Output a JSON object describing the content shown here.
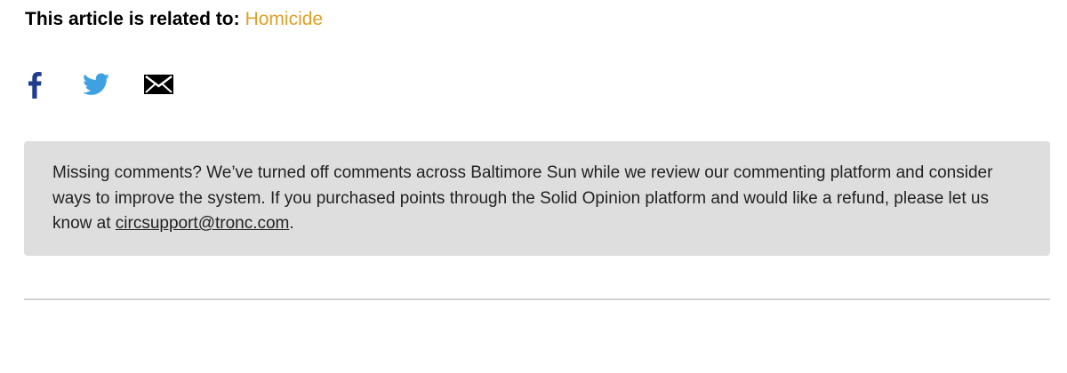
{
  "related": {
    "label": "This article is related to:",
    "topic": "Homicide"
  },
  "share": {
    "facebook_icon": "facebook-icon",
    "twitter_icon": "twitter-icon",
    "email_icon": "email-icon"
  },
  "notice": {
    "text": "Missing comments? We’ve turned off comments across Baltimore Sun while we review our commenting platform and consider ways to improve the system. If you purchased points through the Solid Opinion platform and would like a refund, please let us know at ",
    "email": "circsupport@tronc.com",
    "trailing": "."
  },
  "colors": {
    "topic_link": "#e0a028",
    "facebook": "#1f3d8c",
    "twitter": "#3fa2e0",
    "notice_bg": "#dedede"
  }
}
